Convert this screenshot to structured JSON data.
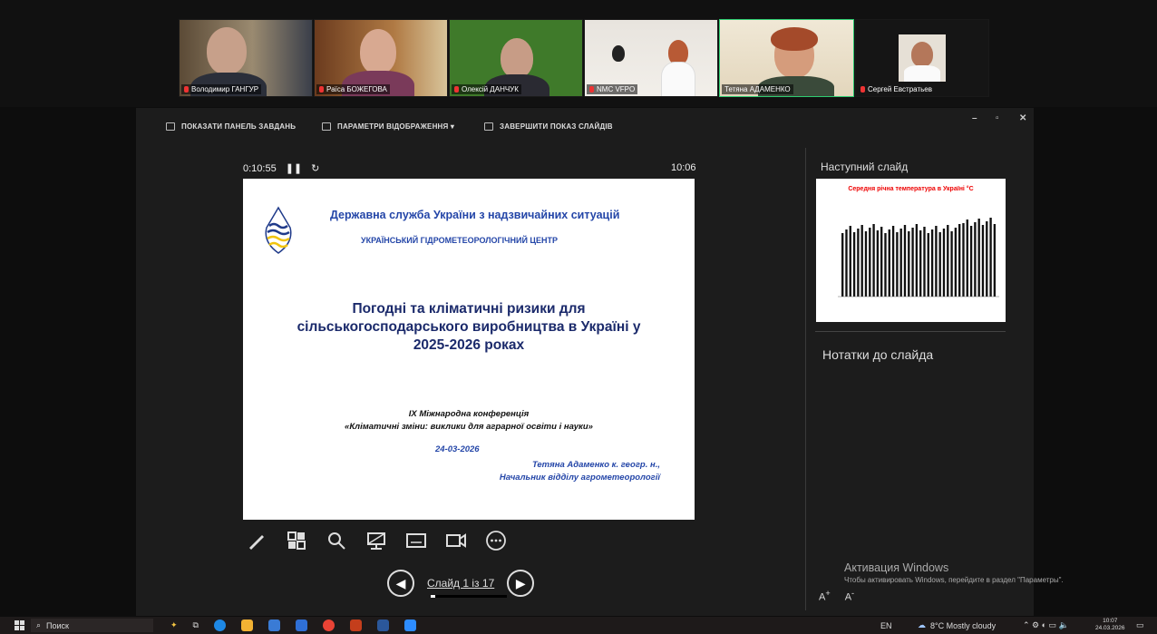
{
  "participants": [
    {
      "name": "Володимир ГАНГУР"
    },
    {
      "name": "Раїса БОЖЕГОВА"
    },
    {
      "name": "Олексій ДАНЧУК"
    },
    {
      "name": "NMC VFPO"
    },
    {
      "name": "Тетяна АДАМЕНКО"
    },
    {
      "name": "Сергей Евстратьев"
    }
  ],
  "toolbar": {
    "show_taskbar": "ПОКАЗАТИ ПАНЕЛЬ ЗАВДАНЬ",
    "display_settings": "ПАРАМЕТРИ ВІДОБРАЖЕННЯ ▾",
    "end_show": "ЗАВЕРШИТИ ПОКАЗ СЛАЙДІВ"
  },
  "timer": {
    "elapsed": "0:10:55",
    "clock": "10:06"
  },
  "slide": {
    "org": "Державна служба України з надзвичайних ситуацій",
    "center": "УКРАЇНСЬКИЙ ГІДРОМЕТЕОРОЛОГІЧНИЙ ЦЕНТР",
    "title_line1": "Погодні та кліматичні ризики для",
    "title_line2": "сільськогосподарського виробництва  в Україні у",
    "title_line3": "2025-2026 роках",
    "conf_line1": "IX Міжнародна конференція",
    "conf_line2": "«Кліматичні зміни: виклики для аграрної освіти і науки»",
    "date": "24-03-2026",
    "author_line1": "Тетяна Адаменко  к. геогр. н.,",
    "author_line2": "Начальник відділу агрометеорології"
  },
  "nav": {
    "slide_counter": "Слайд 1 із 17",
    "progress_fraction": 0.06
  },
  "sidebar": {
    "next_slide_label": "Наступний слайд",
    "next_slide_title": "Середня річна температура в Україні °С",
    "notes_label": "Нотатки до слайда",
    "font_increase": "A",
    "font_decrease": "A"
  },
  "activation": {
    "title": "Активация Windows",
    "text": "Чтобы активировать Windows, перейдите в раздел \"Параметры\"."
  },
  "taskbar": {
    "search_placeholder": "Поиск",
    "lang": "EN",
    "weather": "8°C  Mostly cloudy",
    "time": "10:07",
    "date": "24.03.2026"
  },
  "colors": {
    "active_speaker": "#2ecc71",
    "slide_blue": "#2446a8",
    "chart_title": "#e00000"
  }
}
